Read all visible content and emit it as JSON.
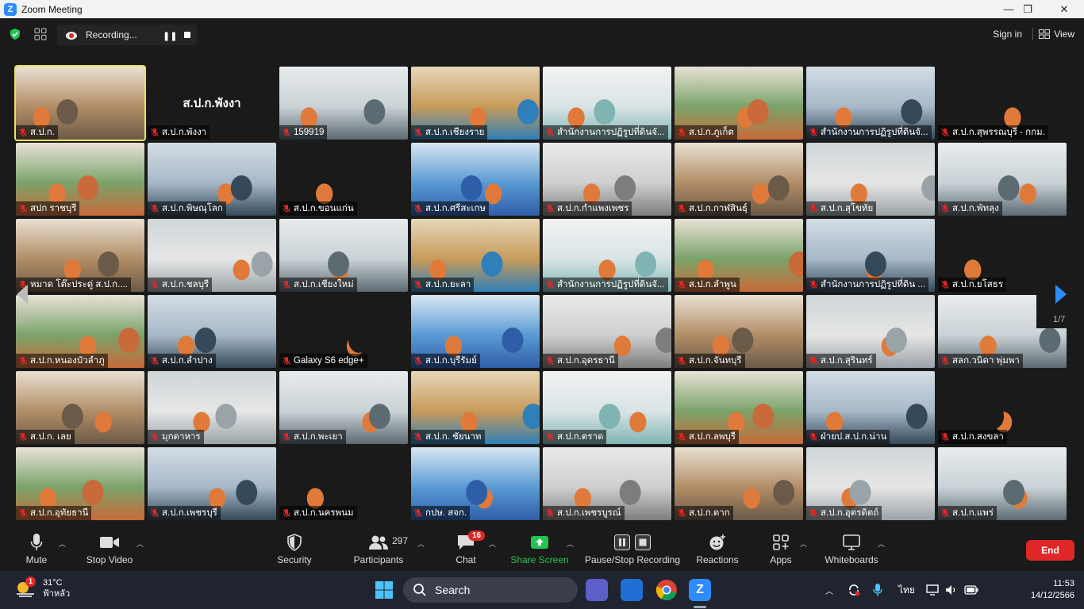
{
  "window": {
    "title": "Zoom Meeting",
    "minimize": "—",
    "restore": "❐",
    "close": "✕"
  },
  "topbar": {
    "recording_label": "Recording...",
    "signin_label": "Sign in",
    "view_label": "View"
  },
  "tiles": [
    {
      "name": "ส.ป.ก.",
      "mic": "muted"
    },
    {
      "name": "ส.ป.ก.พังงา",
      "mic": "muted",
      "bigname": "ส.ป.ก.พังงา"
    },
    {
      "name": "159919",
      "mic": "muted"
    },
    {
      "name": "ส.ป.ก.เชียงราย",
      "mic": "muted"
    },
    {
      "name": "สำนักงานการปฏิรูปที่ดินจั...",
      "mic": "muted"
    },
    {
      "name": "ส.ป.ก.ภูเก็ต",
      "mic": "muted"
    },
    {
      "name": "สำนักงานการปฏิรูปที่ดินจั...",
      "mic": "muted"
    },
    {
      "name": "ส.ป.ก.สุพรรณบุรี - กกม.",
      "mic": "muted"
    },
    {
      "name": "สปก ราชบุรี",
      "mic": "muted"
    },
    {
      "name": "ส.ป.ก.พิษณุโลก",
      "mic": "muted"
    },
    {
      "name": "ส.ป.ก.ขอนแก่น",
      "mic": "muted"
    },
    {
      "name": "ส.ป.ก.ศรีสะเกษ",
      "mic": "muted"
    },
    {
      "name": "ส.ป.ก.กำแพงเพชร",
      "mic": "muted"
    },
    {
      "name": "ส.ป.ก.กาฬสินธุ์",
      "mic": "muted"
    },
    {
      "name": "ส.ป.ก.สุโขทัย",
      "mic": "muted"
    },
    {
      "name": "ส.ป.ก.พัทลุง",
      "mic": "muted"
    },
    {
      "name": "หมาด โต๊ะประดู่ ส.ป.ก....",
      "mic": "muted"
    },
    {
      "name": "ส.ป.ก.ชลบุรี",
      "mic": "muted"
    },
    {
      "name": "ส.ป.ก.เชียงใหม่",
      "mic": "muted"
    },
    {
      "name": "ส.ป.ก.ยะลา",
      "mic": "muted"
    },
    {
      "name": "สำนักงานการปฏิรูปที่ดินจั...",
      "mic": "muted"
    },
    {
      "name": "ส.ป.ก.ลำพูน",
      "mic": "muted"
    },
    {
      "name": "สำนักงานการปฏิรูปที่ดิน ...",
      "mic": "muted"
    },
    {
      "name": "ส.ป.ก.ยโสธร",
      "mic": "muted"
    },
    {
      "name": "ส.ป.ก.หนองบัวลำภู",
      "mic": "muted"
    },
    {
      "name": "ส.ป.ก.ลำปาง",
      "mic": "muted"
    },
    {
      "name": "Galaxy S6 edge+",
      "mic": "muted"
    },
    {
      "name": "ส.ป.ก.บุรีรัมย์",
      "mic": "muted"
    },
    {
      "name": "ส.ป.ก.อุดรธานี",
      "mic": "muted"
    },
    {
      "name": "ส.ป.ก.จันทบุรี",
      "mic": "muted"
    },
    {
      "name": "ส.ป.ก.สุรินทร์",
      "mic": "muted"
    },
    {
      "name": "สลก.วนิดา พุ่มพา",
      "mic": "muted"
    },
    {
      "name": "ส.ป.ก. เลย",
      "mic": "muted"
    },
    {
      "name": "มุกดาหาร",
      "mic": "muted"
    },
    {
      "name": "ส.ป.ก.พะเยา",
      "mic": "muted"
    },
    {
      "name": "ส.ป.ก. ชัยนาท",
      "mic": "muted"
    },
    {
      "name": "ส.ป.ก.ตราด",
      "mic": "muted"
    },
    {
      "name": "ส.ป.ก.ลพบุรี",
      "mic": "muted"
    },
    {
      "name": "ฝ่ายป.ส.ป.ก.น่าน",
      "mic": "muted"
    },
    {
      "name": "ส.ป.ก.สงขลา",
      "mic": "muted"
    },
    {
      "name": "ส.ป.ก.อุทัยธานี",
      "mic": "muted"
    },
    {
      "name": "ส.ป.ก.เพชรบุรี",
      "mic": "muted"
    },
    {
      "name": "ส.ป.ก.นครพนม",
      "mic": "muted"
    },
    {
      "name": "กปษ. สจก.",
      "mic": "muted"
    },
    {
      "name": "ส.ป.ก.เพชรบูรณ์",
      "mic": "muted"
    },
    {
      "name": "ส.ป.ก.ตาก",
      "mic": "muted"
    },
    {
      "name": "ส.ป.ก.อุตรดิตถ์",
      "mic": "muted"
    },
    {
      "name": "ส.ป.ก.แพร่",
      "mic": "muted"
    }
  ],
  "paging": {
    "left_label": "1/7",
    "right_label": "1/7"
  },
  "toolbar": {
    "mute": "Mute",
    "stop_video": "Stop Video",
    "security": "Security",
    "participants": "Participants",
    "participants_count": "297",
    "chat": "Chat",
    "chat_badge": "16",
    "share_screen": "Share Screen",
    "pause_stop_recording": "Pause/Stop Recording",
    "reactions": "Reactions",
    "apps": "Apps",
    "whiteboards": "Whiteboards",
    "end": "End",
    "share_color": "#23c552",
    "end_color": "#e02828"
  },
  "taskbar": {
    "weather_temp": "31°C",
    "weather_desc": "ฟ้าหลัว",
    "weather_badge": "1",
    "search_label": "Search",
    "lang": "ไทย",
    "time": "11:53",
    "date": "14/12/2566"
  }
}
